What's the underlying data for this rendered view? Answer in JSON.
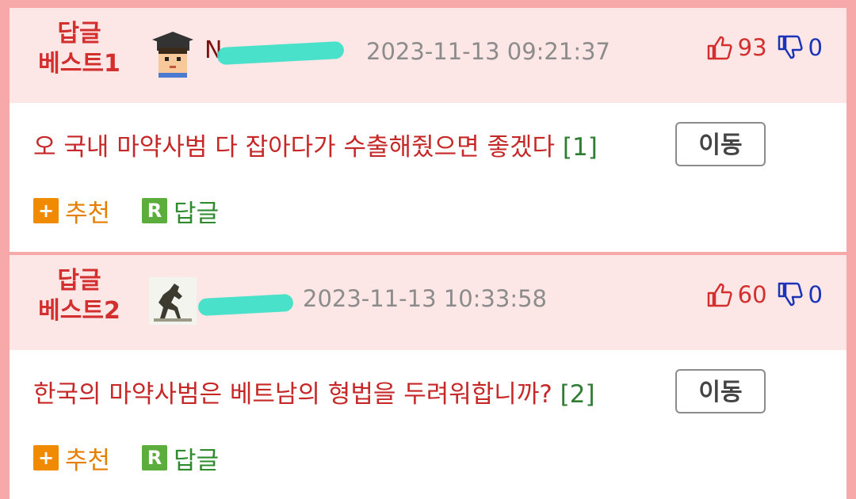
{
  "posts": [
    {
      "rank_line1": "답글",
      "rank_line2": "베스트1",
      "avatar": "student-graduation-cap-avatar",
      "author_visible": "N",
      "author_trailing": "",
      "timestamp": "2023-11-13 09:21:37",
      "upvotes": "93",
      "downvotes": "0",
      "title": "오 국내 마약사범 다 잡아다가 수출해줬으면 좋겠다",
      "reply_count": "[1]",
      "move_label": "이동",
      "recommend_label": "추천",
      "reply_label": "답글",
      "plus_badge": "+",
      "r_badge": "R"
    },
    {
      "rank_line1": "답글",
      "rank_line2": "베스트2",
      "avatar": "horse-statue-avatar",
      "author_visible": "",
      "author_trailing": "",
      "timestamp": "2023-11-13 10:33:58",
      "upvotes": "60",
      "downvotes": "0",
      "title": "한국의 마약사범은 베트남의 형법을 두려워합니까?",
      "reply_count": "[2]",
      "move_label": "이동",
      "recommend_label": "추천",
      "reply_label": "답글",
      "plus_badge": "+",
      "r_badge": "R"
    }
  ],
  "colors": {
    "page_border": "#f7a9a9",
    "header_bg": "#fde6e6",
    "rank_red": "#d32f2f",
    "title_red": "#c62828",
    "reply_green": "#2e7d32",
    "downvote_blue": "#1a33b8",
    "recommend_orange": "#e67e00"
  },
  "icons": [
    "thumbs-up-icon",
    "thumbs-down-icon",
    "plus-badge-icon",
    "r-badge-icon"
  ]
}
